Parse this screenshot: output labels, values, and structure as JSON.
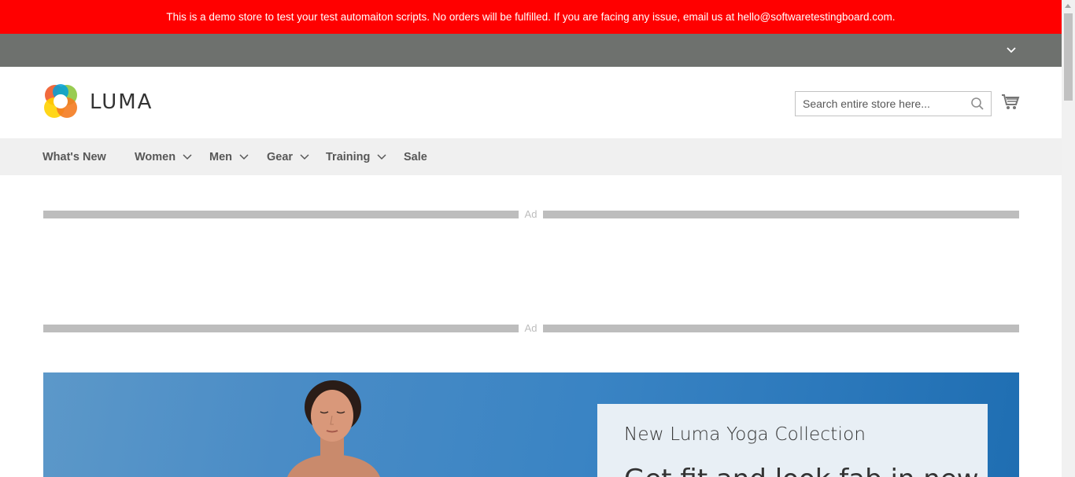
{
  "demo_notice": "This is a demo store to test your test automaiton scripts. No orders will be fulfilled. If you are facing any issue, email us at hello@softwaretestingboard.com.",
  "header": {
    "logo_text": "LUMA",
    "search_placeholder": "Search entire store here...",
    "search_icon": "search-icon",
    "cart_icon": "cart-icon"
  },
  "nav": {
    "items": [
      {
        "label": "What's New",
        "has_dropdown": false
      },
      {
        "label": "Women",
        "has_dropdown": true
      },
      {
        "label": "Men",
        "has_dropdown": true
      },
      {
        "label": "Gear",
        "has_dropdown": true
      },
      {
        "label": "Training",
        "has_dropdown": true
      },
      {
        "label": "Sale",
        "has_dropdown": false
      }
    ]
  },
  "ads": {
    "top_label": "Ad",
    "bottom_label": "Ad"
  },
  "hero": {
    "title": "New Luma Yoga Collection",
    "subtitle": "Get fit and look fab in new"
  },
  "colors": {
    "demo_bar": "#ff0000",
    "panel_bar": "#6e716e",
    "nav_bg": "#f0f0f0",
    "ad_line": "#bdbdbd",
    "hero_blue": "#3a84c4"
  }
}
